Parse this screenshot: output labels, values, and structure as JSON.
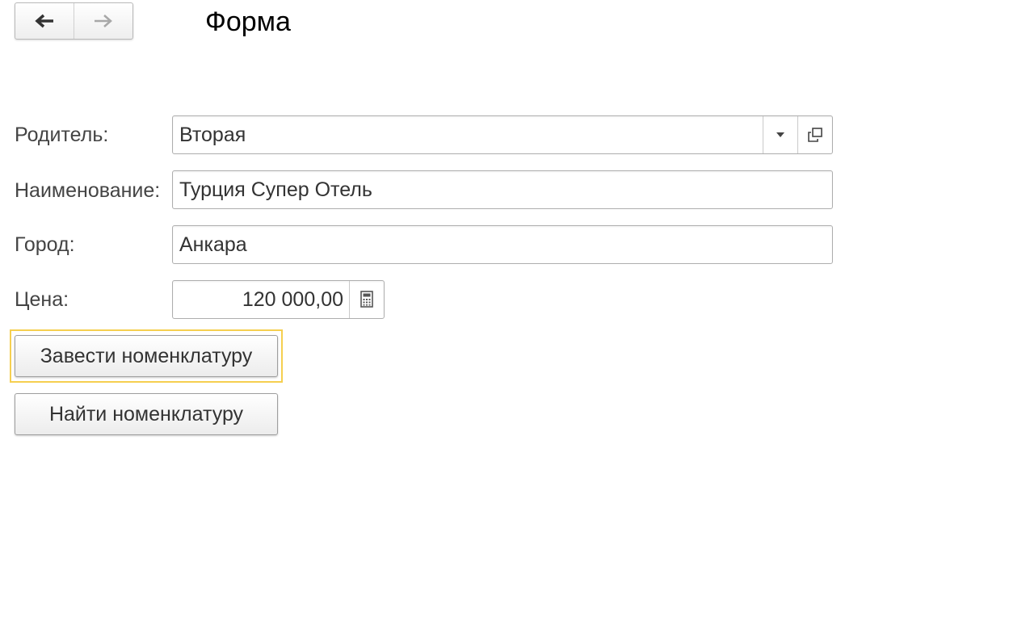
{
  "header": {
    "title": "Форма"
  },
  "fields": {
    "parent": {
      "label": "Родитель:",
      "value": "Вторая"
    },
    "name": {
      "label": "Наименование:",
      "value": "Турция Супер Отель"
    },
    "city": {
      "label": "Город:",
      "value": "Анкара"
    },
    "price": {
      "label": "Цена:",
      "value": "120 000,00"
    }
  },
  "buttons": {
    "create_item": "Завести номенклатуру",
    "find_item": "Найти номенклатуру"
  },
  "icons": {
    "back": "arrow-left-icon",
    "forward": "arrow-right-icon",
    "dropdown": "chevron-down-icon",
    "open": "open-window-icon",
    "calculator": "calculator-icon"
  },
  "colors": {
    "focus_frame": "#f5cf50",
    "field_border": "#aeaeae"
  }
}
